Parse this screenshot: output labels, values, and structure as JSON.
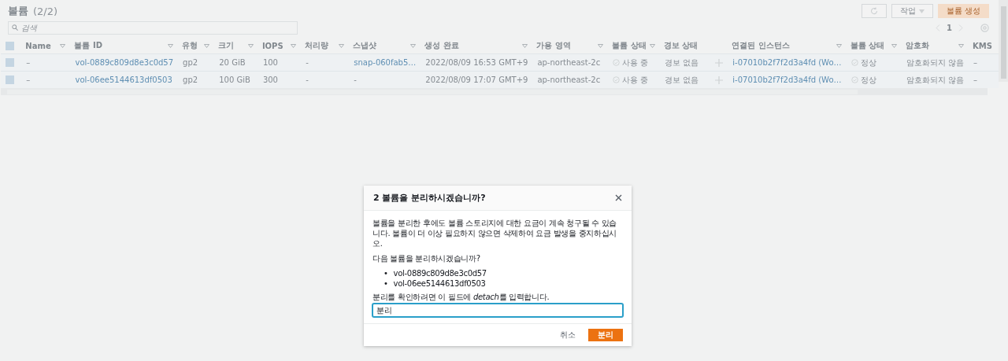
{
  "page": {
    "title": "볼륨",
    "count": "(2/2)",
    "search": {
      "placeholder": "검색"
    },
    "actions_button": "작업",
    "create_button": "볼륨 생성",
    "page_number": "1"
  },
  "table": {
    "header_checked": true,
    "columns": [
      {
        "label": "Name",
        "sortable": true
      },
      {
        "label": "볼륨 ID",
        "sortable": true
      },
      {
        "label": "유형",
        "sortable": true
      },
      {
        "label": "크기",
        "sortable": true
      },
      {
        "label": "IOPS",
        "sortable": true
      },
      {
        "label": "처리량",
        "sortable": true
      },
      {
        "label": "스냅샷",
        "sortable": true
      },
      {
        "label": "생성 완료",
        "sortable": true
      },
      {
        "label": "가용 영역",
        "sortable": true
      },
      {
        "label": "볼륨 상태",
        "sortable": true
      },
      {
        "label": "경보 상태",
        "sortable": false
      },
      {
        "label": "연결된 인스턴스",
        "sortable": true
      },
      {
        "label": "볼륨 상태",
        "sortable": true
      },
      {
        "label": "암호화",
        "sortable": true
      },
      {
        "label": "KMS",
        "sortable": false
      }
    ],
    "rows": [
      {
        "selected": true,
        "cells": [
          {
            "kind": "text",
            "text": "–"
          },
          {
            "kind": "link",
            "text": "vol-0889c809d8e3c0d57"
          },
          {
            "kind": "text",
            "text": "gp2"
          },
          {
            "kind": "text",
            "text": "20 GiB"
          },
          {
            "kind": "text",
            "text": "100"
          },
          {
            "kind": "text",
            "text": "-"
          },
          {
            "kind": "link",
            "text": "snap-060fab5…"
          },
          {
            "kind": "text",
            "text": "2022/08/09 16:53 GMT+9"
          },
          {
            "kind": "text",
            "text": "ap-northeast-2c"
          },
          {
            "kind": "status",
            "text": "사용 중"
          },
          {
            "kind": "alarm",
            "text": "경보 없음"
          },
          {
            "kind": "link",
            "text": "i-07010b2f7f2d3a4fd (Wo…"
          },
          {
            "kind": "status",
            "text": "정상"
          },
          {
            "kind": "text",
            "text": "암호화되지 않음"
          },
          {
            "kind": "text",
            "text": "–"
          }
        ]
      },
      {
        "selected": true,
        "cells": [
          {
            "kind": "text",
            "text": "–"
          },
          {
            "kind": "link",
            "text": "vol-06ee5144613df0503"
          },
          {
            "kind": "text",
            "text": "gp2"
          },
          {
            "kind": "text",
            "text": "100 GiB"
          },
          {
            "kind": "text",
            "text": "300"
          },
          {
            "kind": "text",
            "text": "-"
          },
          {
            "kind": "text",
            "text": "-"
          },
          {
            "kind": "text",
            "text": "2022/08/09 17:07 GMT+9"
          },
          {
            "kind": "text",
            "text": "ap-northeast-2c"
          },
          {
            "kind": "status",
            "text": "사용 중"
          },
          {
            "kind": "alarm",
            "text": "경보 없음"
          },
          {
            "kind": "link",
            "text": "i-07010b2f7f2d3a4fd (Wo…"
          },
          {
            "kind": "status",
            "text": "정상"
          },
          {
            "kind": "text",
            "text": "암호화되지 않음"
          },
          {
            "kind": "text",
            "text": "–"
          }
        ]
      }
    ]
  },
  "dialog": {
    "title": "2 볼륨을 분리하시겠습니까?",
    "warning": "볼륨을 분리한 후에도 볼륨 스토리지에 대한 요금이 계속 청구될 수 있습니다. 볼륨이 더 이상 필요하지 않으면 삭제하여 요금 발생을 중지하십시오.",
    "question": "다음 볼륨을 분리하시겠습니까?",
    "volumes": [
      {
        "bullet": "•",
        "id": "vol-0889c809d8e3c0d57"
      },
      {
        "bullet": "•",
        "id": "vol-06ee5144613df0503"
      }
    ],
    "confirm_label": {
      "before": "분리를 확인하려면 이 필드에 ",
      "keyword": "detach",
      "after": "를 입력합니다."
    },
    "confirm_value": "분리",
    "cancel_button": "취소",
    "detach_button": "분리"
  }
}
